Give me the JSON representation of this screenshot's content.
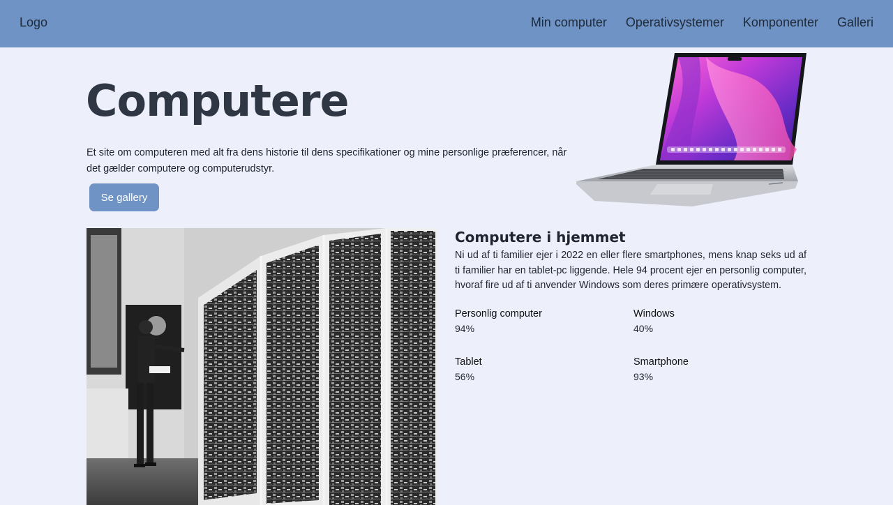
{
  "nav": {
    "logo": "Logo",
    "links": [
      "Min computer",
      "Operativsystemer",
      "Komponenter",
      "Galleri"
    ]
  },
  "hero": {
    "title": "Computere",
    "description": "Et site om computeren med alt fra dens historie til dens specifikationer og mine personlige præferencer, når det gælder computere og computerudstyr.",
    "button_label": "Se gallery"
  },
  "info": {
    "title": "Computere i hjemmet",
    "text": "Ni ud af ti familier ejer i 2022 en eller flere smartphones, mens knap seks ud af ti familier har en tablet-pc liggende. Hele 94 procent ejer en personlig computer, hvoraf fire ud af ti anvender Windows som deres primære operativsystem.",
    "stats": [
      {
        "label": "Personlig computer",
        "value": "94%"
      },
      {
        "label": "Windows",
        "value": "40%"
      },
      {
        "label": "Tablet",
        "value": "56%"
      },
      {
        "label": "Smartphone",
        "value": "93%"
      }
    ]
  },
  "colors": {
    "navbar": "#6f93c4",
    "background": "#edf0fb",
    "button": "#6f93c4"
  },
  "images": {
    "laptop": "laptop-image",
    "photo": "vintage-computer-photo"
  }
}
